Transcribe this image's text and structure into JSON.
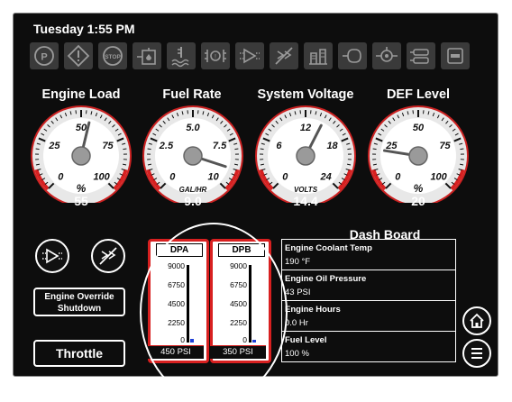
{
  "header": {
    "datetime": "Tuesday 1:55 PM"
  },
  "toolbar_icons": [
    "park-brake-icon",
    "warning-icon",
    "stop-icon",
    "water-in-fuel-icon",
    "coolant-temp-icon",
    "transmission-icon",
    "transmission-alt-icon",
    "regen-inhibit-icon",
    "dpf-icon",
    "glow-plug-icon",
    "oil-pressure-icon",
    "battery-icon",
    "def-icon"
  ],
  "gauges": [
    {
      "title": "Engine Load",
      "value": "55",
      "unit_label": "%",
      "ticks": [
        "0",
        "25",
        "50",
        "75",
        "100"
      ],
      "needle_fraction": 0.55
    },
    {
      "title": "Fuel Rate",
      "value": "9.0",
      "unit_label": "GAL/HR",
      "ticks": [
        "0",
        "2.5",
        "5.0",
        "7.5",
        "10"
      ],
      "needle_fraction": 0.9
    },
    {
      "title": "System Voltage",
      "value": "14.4",
      "unit_label": "VOLTS",
      "ticks": [
        "0",
        "6",
        "12",
        "18",
        "24"
      ],
      "needle_fraction": 0.6
    },
    {
      "title": "DEF Level",
      "value": "20",
      "unit_label": "%",
      "ticks": [
        "0",
        "25",
        "50",
        "75",
        "100"
      ],
      "needle_fraction": 0.2
    }
  ],
  "controls": {
    "btn1_icon": "transmission-icon",
    "btn2_icon": "regen-inhibit-icon",
    "override_label": "Engine Override Shutdown",
    "throttle_label": "Throttle"
  },
  "dpf": [
    {
      "title": "DPA",
      "ticks": [
        "9000",
        "6750",
        "4500",
        "2250",
        "0"
      ],
      "pressure": "450 PSI",
      "fill_fraction": 0.05
    },
    {
      "title": "DPB",
      "ticks": [
        "9000",
        "6750",
        "4500",
        "2250",
        "0"
      ],
      "pressure": "350 PSI",
      "fill_fraction": 0.04
    }
  ],
  "dashboard": {
    "title": "Dash Board",
    "rows": [
      {
        "label": "Engine Coolant Temp",
        "value": "190 °F"
      },
      {
        "label": "Engine Oil Pressure",
        "value": "43 PSI"
      },
      {
        "label": "Engine Hours",
        "value": "0.0 Hr"
      },
      {
        "label": "Fuel Level",
        "value": "100 %"
      }
    ]
  },
  "nav": {
    "home_icon": "home-icon",
    "menu_icon": "menu-icon"
  },
  "colors": {
    "background": "#0d0d0d",
    "accent_red": "#d82020",
    "fill_blue": "#1d3fd8",
    "tile_gray": "#3a3a3a"
  }
}
